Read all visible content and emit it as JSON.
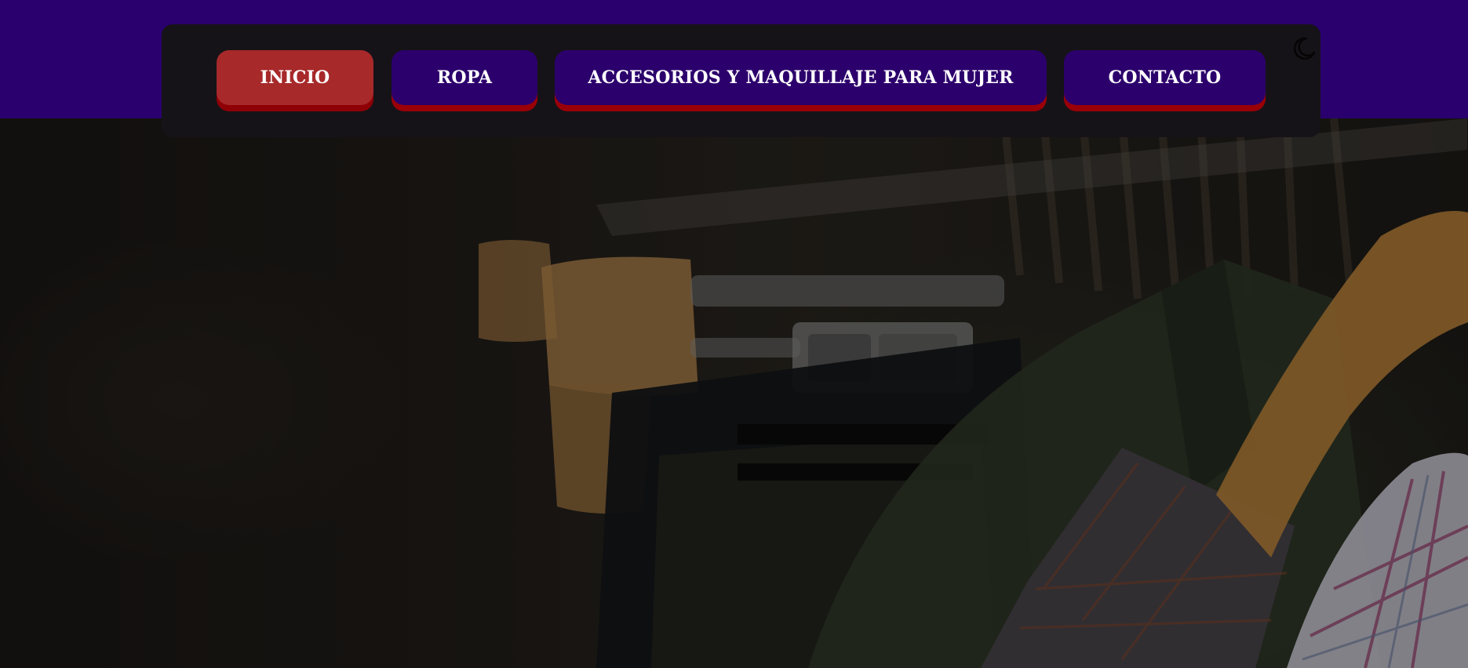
{
  "nav": {
    "items": [
      {
        "label": "INICIO",
        "active": true
      },
      {
        "label": "ROPA",
        "active": false
      },
      {
        "label": "ACCESORIOS Y MAQUILLAJE PARA MUJER",
        "active": false
      },
      {
        "label": "CONTACTO",
        "active": false
      }
    ],
    "theme_toggle_icon": "moon-icon"
  },
  "colors": {
    "header_band": "#2a006e",
    "navbar_bg": "#161318",
    "button_bg": "#2c006c",
    "button_active_bg": "#a7292a",
    "button_shadow": "#9a0007",
    "button_text": "#ffffff"
  },
  "hero": {
    "image": "clothes-on-wooden-hangers-photo"
  }
}
